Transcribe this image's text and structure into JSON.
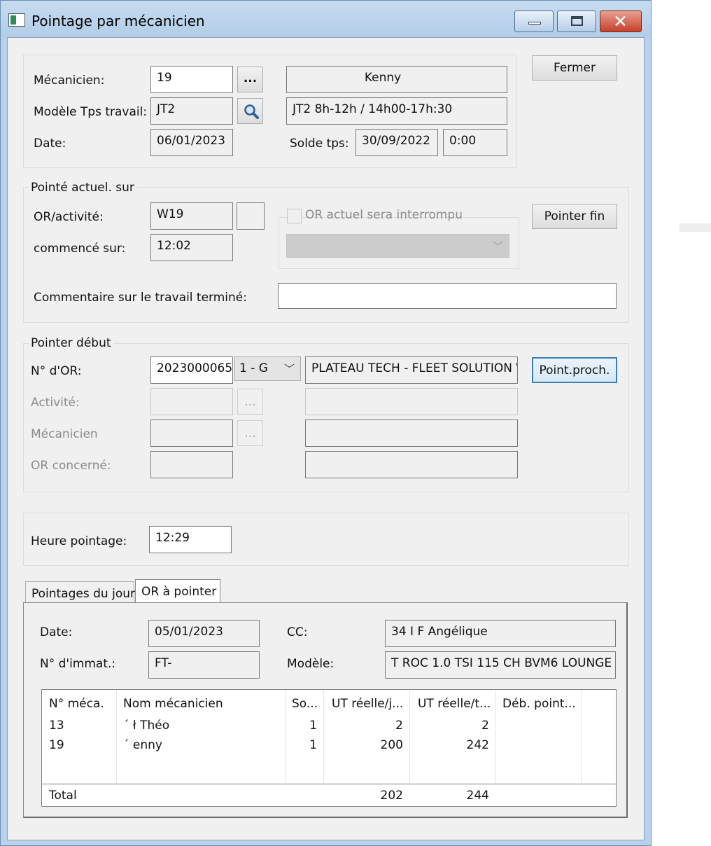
{
  "window": {
    "title": "Pointage par mécanicien",
    "icon": "app-window-icon"
  },
  "header": {
    "mecanicien_label": "Mécanicien:",
    "mecanicien_value": "19",
    "mecanicien_browse": "...",
    "mecanicien_name": "Kenny",
    "modele_label": "Modèle Tps travail:",
    "modele_value": "JT2",
    "modele_desc": "JT2 8h-12h / 14h00-17h:30",
    "date_label": "Date:",
    "date_value": "06/01/2023",
    "solde_label": "Solde tps:",
    "solde_date": "30/09/2022",
    "solde_time": "0:00",
    "fermer_label": "Fermer"
  },
  "current": {
    "legend": "Pointé actuel. sur",
    "or_label": "OR/activité:",
    "or_value": "W19",
    "commence_label": "commencé sur:",
    "commence_value": "12:02",
    "interrompu_label": "OR actuel sera interrompu",
    "pointer_fin_label": "Pointer fin",
    "commentaire_label": "Commentaire sur le travail terminé:",
    "commentaire_value": ""
  },
  "start": {
    "legend": "Pointer début",
    "nor_label": "N° d'OR:",
    "nor_value": "2023000065",
    "nor_combo": "1 - G",
    "nor_desc": "PLATEAU TECH - FLEET SOLUTION \\",
    "point_proch_label": "Point.proch.",
    "activite_label": "Activité:",
    "mecanicien_label": "Mécanicien",
    "or_concerne_label": "OR concerné:",
    "browse": "..."
  },
  "heure": {
    "label": "Heure pointage:",
    "value": "12:29"
  },
  "tabs": [
    {
      "label": "Pointages du jour"
    },
    {
      "label": "OR à pointer"
    }
  ],
  "tab_panel": {
    "date_label": "Date:",
    "date_value": "05/01/2023",
    "cc_label": "CC:",
    "cc_value": "34 I             F Angélique",
    "immat_label": "N° d'immat.:",
    "immat_value": "FT-",
    "modele_label": "Modèle:",
    "modele_value": "T ROC 1.0 TSI 115 CH BVM6 LOUNGE"
  },
  "table": {
    "columns": [
      "N° méca.",
      "Nom mécanicien",
      "So...",
      "UT réelle/j...",
      "UT réelle/t...",
      "Déb. point..."
    ],
    "rows": [
      [
        "13",
        "´            ł Théo",
        "1",
        "2",
        "2",
        ""
      ],
      [
        "19",
        "´          enny",
        "1",
        "200",
        "242",
        ""
      ]
    ],
    "total": [
      "Total",
      "",
      "",
      "202",
      "244",
      ""
    ]
  }
}
